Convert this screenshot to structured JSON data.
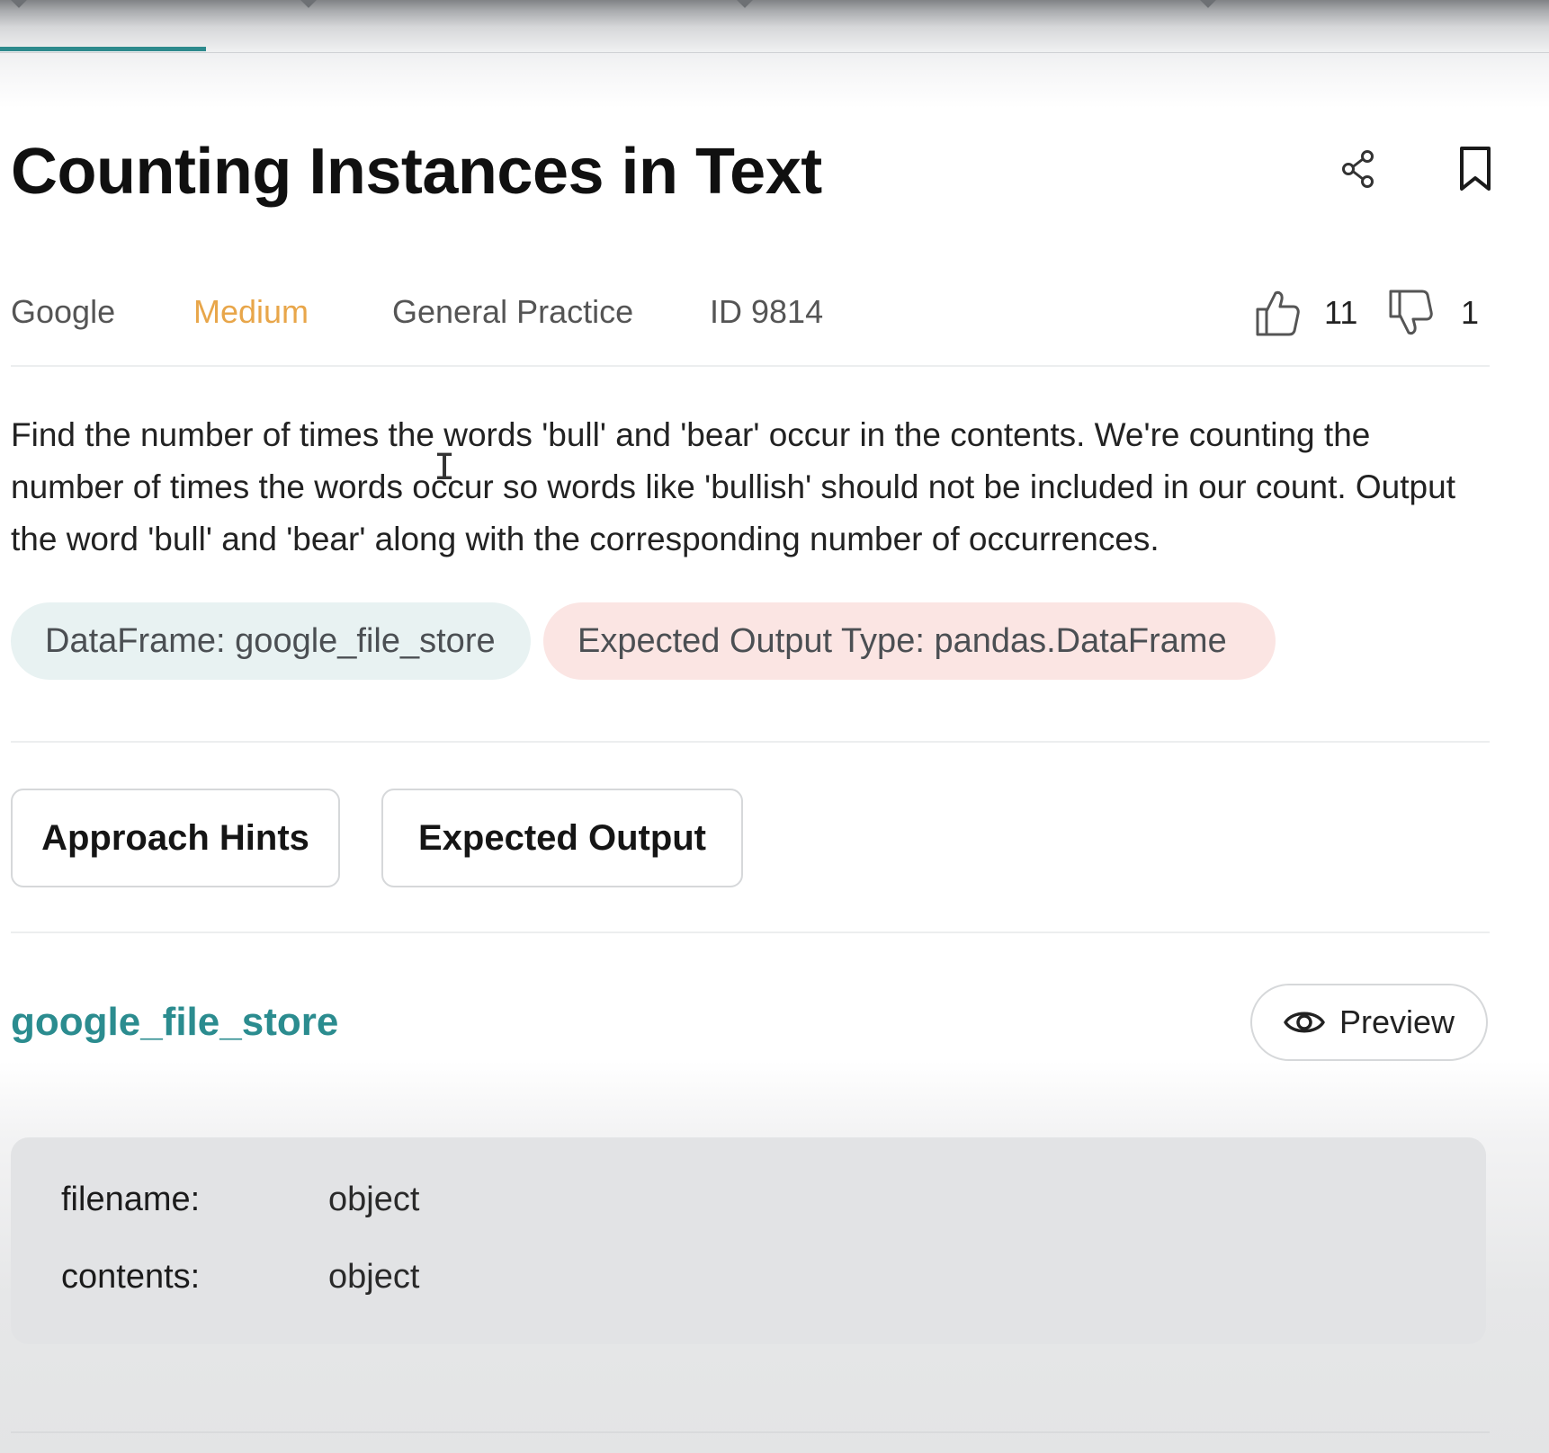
{
  "question": {
    "title": "Counting Instances in Text",
    "company": "Google",
    "difficulty": "Medium",
    "category": "General Practice",
    "id_label": "ID 9814",
    "upvotes": "11",
    "downvotes": "1",
    "description": "Find the number of times the words 'bull' and 'bear' occur in the contents. We're counting the number of times the words occur so words like 'bullish' should not be included in our count. Output the word 'bull' and 'bear' along with the corresponding number of occurrences."
  },
  "tags": {
    "dataframe": "DataFrame: google_file_store",
    "output_type": "Expected Output Type: pandas.DataFrame"
  },
  "buttons": {
    "approach_hints": "Approach Hints",
    "expected_output": "Expected Output",
    "preview": "Preview"
  },
  "table": {
    "name": "google_file_store",
    "columns": [
      {
        "name": "filename:",
        "type": "object"
      },
      {
        "name": "contents:",
        "type": "object"
      }
    ]
  },
  "icons": {
    "share": "share-icon",
    "bookmark": "bookmark-icon",
    "thumbs_up": "thumbs-up-icon",
    "thumbs_down": "thumbs-down-icon",
    "eye": "eye-icon"
  },
  "colors": {
    "accent": "#2b8c8f",
    "difficulty_medium": "#e8a64a",
    "pill_teal_bg": "#e8f2f2",
    "pill_pink_bg": "#fbe5e3"
  }
}
